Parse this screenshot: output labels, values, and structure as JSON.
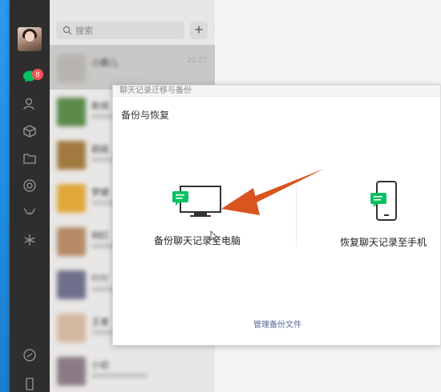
{
  "search": {
    "placeholder": "搜索"
  },
  "add_button": {
    "label": "+"
  },
  "nav": {
    "badge_count": "8"
  },
  "chats": [
    {
      "name": "小鹿儿",
      "time": "20:27",
      "color": "#b7b3ae"
    },
    {
      "name": "新闻",
      "time": "",
      "color": "#5b8a4b"
    },
    {
      "name": "超级",
      "time": "",
      "color": "#a07a3e"
    },
    {
      "name": "梦婕",
      "time": "",
      "color": "#e0a83a"
    },
    {
      "name": "网红",
      "time": "",
      "color": "#b58a66"
    },
    {
      "name": "吖吖",
      "time": "",
      "color": "#6e6f8a"
    },
    {
      "name": "王者",
      "time": "",
      "color": "#d4b8a0"
    },
    {
      "name": "小初",
      "time": "",
      "color": "#8a7b86"
    }
  ],
  "dialog": {
    "window_title": "聊天记录迁移与备份",
    "heading": "备份与恢复",
    "backup_to_pc": "备份聊天记录至电脑",
    "restore_to_phone": "恢复聊天记录至手机",
    "manage_files": "管理备份文件"
  },
  "colors": {
    "accent_green": "#07c160",
    "arrow": "#d9541e",
    "link": "#576b95"
  }
}
